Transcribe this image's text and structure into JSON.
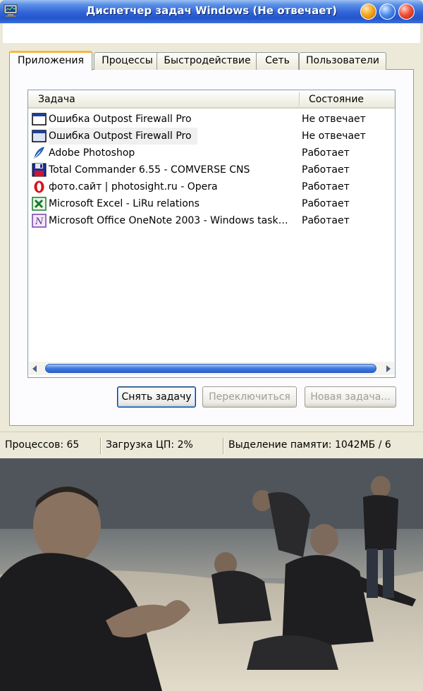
{
  "window": {
    "title": "Диспетчер задач Windows (Не отвечает)"
  },
  "tabs": [
    {
      "label": "Приложения",
      "active": true
    },
    {
      "label": "Процессы",
      "active": false
    },
    {
      "label": "Быстродействие",
      "active": false
    },
    {
      "label": "Сеть",
      "active": false
    },
    {
      "label": "Пользователи",
      "active": false
    }
  ],
  "list": {
    "columns": {
      "task": "Задача",
      "state": "Состояние"
    },
    "rows": [
      {
        "name": "Ошибка Outpost Firewall Pro",
        "state": "Не отвечает",
        "icon": "window-icon"
      },
      {
        "name": "Ошибка Outpost Firewall Pro",
        "state": "Не отвечает",
        "icon": "window-icon"
      },
      {
        "name": "Adobe Photoshop",
        "state": "Работает",
        "icon": "photoshop-feather-icon"
      },
      {
        "name": "Total Commander 6.55 - COMVERSE CNS",
        "state": "Работает",
        "icon": "floppy-disk-icon"
      },
      {
        "name": "фото.сайт | photosight.ru - Opera",
        "state": "Работает",
        "icon": "opera-icon"
      },
      {
        "name": "Microsoft Excel - LiRu relations",
        "state": "Работает",
        "icon": "excel-icon"
      },
      {
        "name": "Microsoft Office OneNote 2003 - Windows task…",
        "state": "Работает",
        "icon": "onenote-icon"
      }
    ]
  },
  "buttons": {
    "end_task": "Снять задачу",
    "switch_to": "Переключиться",
    "new_task": "Новая задача..."
  },
  "status": {
    "processes": "Процессов: 65",
    "cpu": "Загрузка ЦП: 2%",
    "memory": "Выделение памяти: 1042МБ / 6"
  },
  "colors": {
    "titlebar": "#2456c9",
    "tab_highlight": "#f5b942",
    "scroll_thumb": "#3d78e1"
  }
}
